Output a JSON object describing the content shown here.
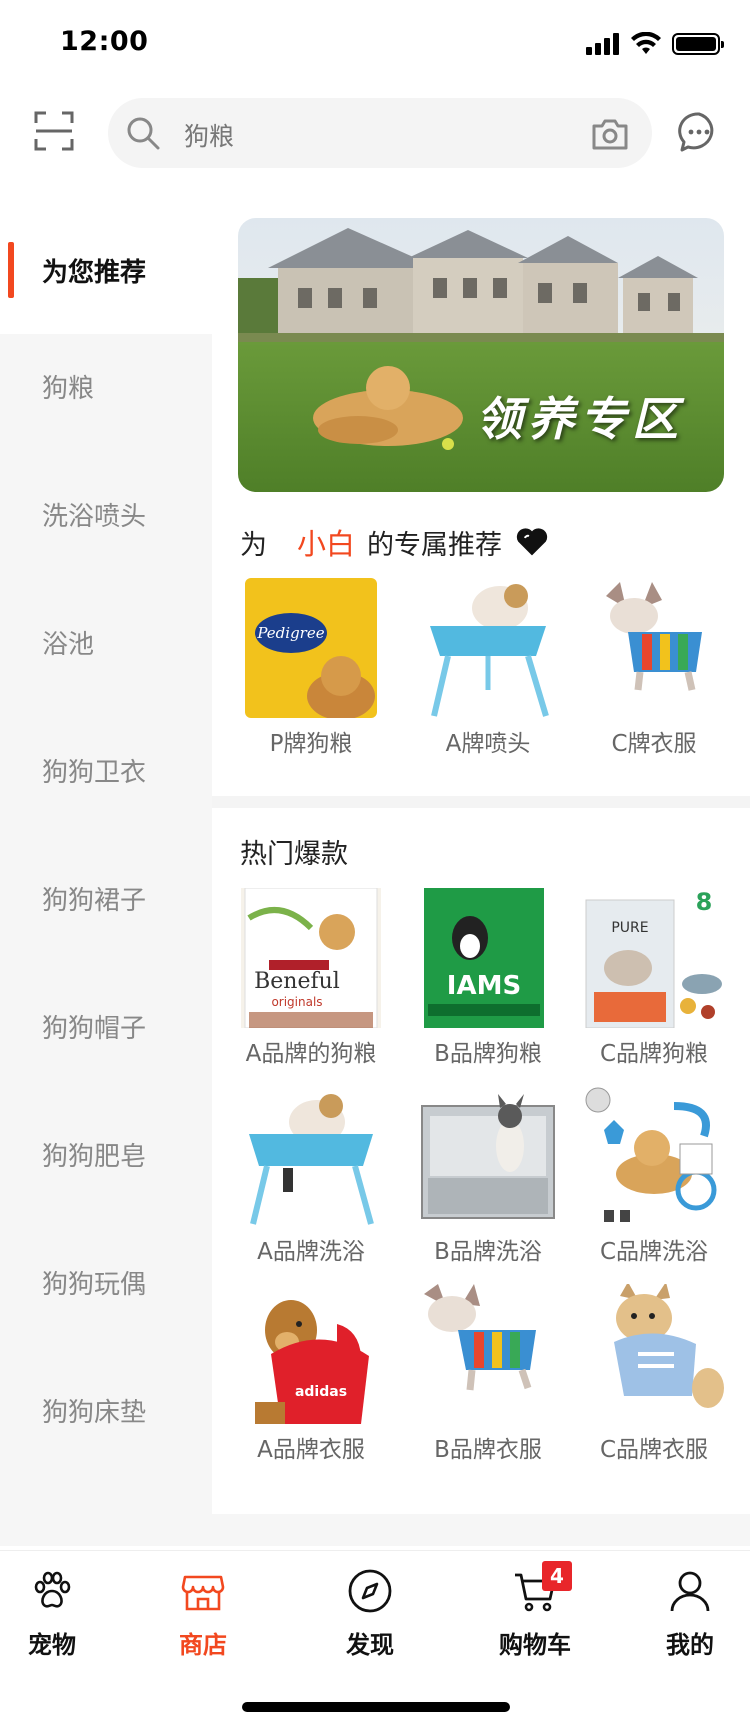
{
  "status_bar": {
    "time": "12:00"
  },
  "search": {
    "text": "狗粮"
  },
  "sidebar": {
    "items": [
      {
        "label": "为您推荐",
        "active": true
      },
      {
        "label": "狗粮"
      },
      {
        "label": "洗浴喷头"
      },
      {
        "label": "浴池"
      },
      {
        "label": "狗狗卫衣"
      },
      {
        "label": "狗狗裙子"
      },
      {
        "label": "狗狗帽子"
      },
      {
        "label": "狗狗肥皂"
      },
      {
        "label": "狗狗玩偶"
      },
      {
        "label": "狗狗床垫"
      }
    ]
  },
  "banner": {
    "title": "领养专区"
  },
  "recommend": {
    "prefix": "为",
    "user": "小白",
    "suffix": "的专属推荐",
    "items": [
      {
        "label": "P牌狗粮"
      },
      {
        "label": "A牌喷头"
      },
      {
        "label": "C牌衣服"
      }
    ]
  },
  "hot": {
    "title": "热门爆款",
    "items": [
      {
        "label": "A品牌的狗粮"
      },
      {
        "label": "B品牌狗粮"
      },
      {
        "label": "C品牌狗粮"
      },
      {
        "label": "A品牌洗浴"
      },
      {
        "label": "B品牌洗浴"
      },
      {
        "label": "C品牌洗浴"
      },
      {
        "label": "A品牌衣服"
      },
      {
        "label": "B品牌衣服"
      },
      {
        "label": "C品牌衣服"
      }
    ]
  },
  "tabbar": {
    "items": [
      {
        "label": "宠物",
        "icon": "paw-icon"
      },
      {
        "label": "商店",
        "icon": "store-icon",
        "active": true
      },
      {
        "label": "发现",
        "icon": "compass-icon"
      },
      {
        "label": "购物车",
        "icon": "cart-icon",
        "badge": "4"
      },
      {
        "label": "我的",
        "icon": "user-icon"
      }
    ]
  },
  "colors": {
    "accent": "#f2481f",
    "badge": "#e8262a"
  }
}
